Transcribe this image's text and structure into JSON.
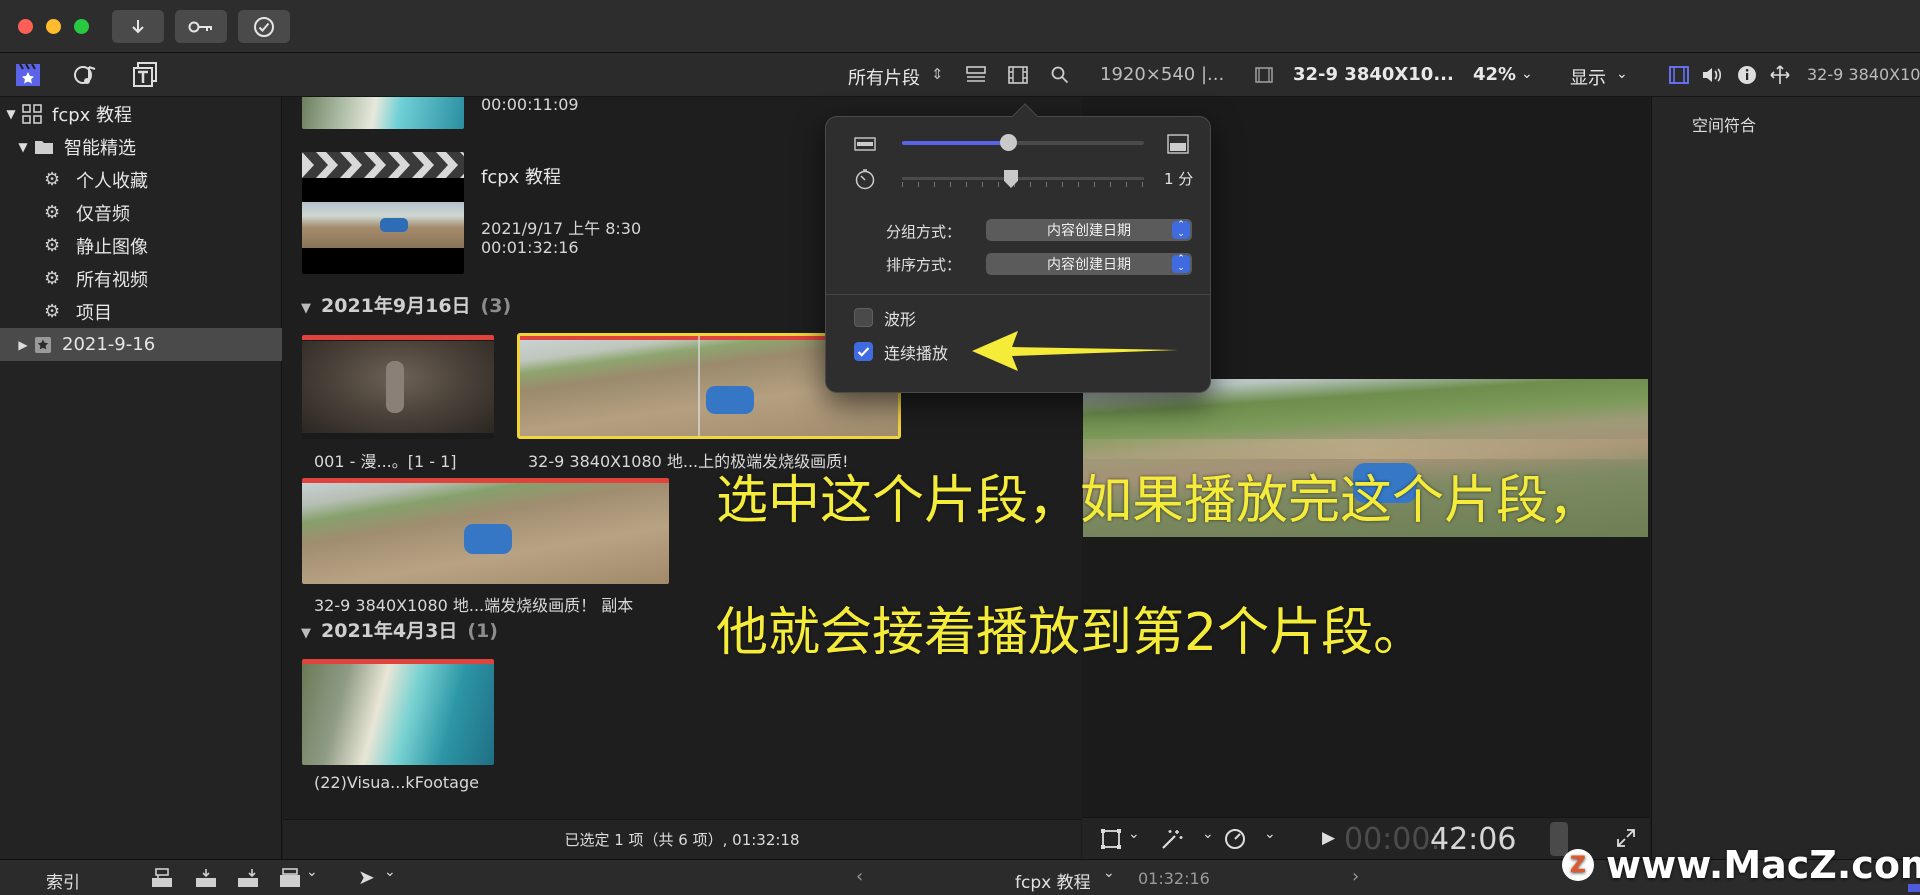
{
  "titlebar": {
    "buttons": [
      "download",
      "key",
      "checkmark"
    ]
  },
  "toolbar": {
    "clips_filter": "所有片段",
    "viewer_format": "1920×540 |...",
    "viewer_clip": "32-9 3840X10...",
    "zoom": "42%",
    "display": "显示",
    "inspector_title": "32-9 3840X10"
  },
  "sidebar": {
    "library": "fcpx 教程",
    "smart_folder": "智能精选",
    "items": [
      "个人收藏",
      "仅音频",
      "静止图像",
      "所有视频",
      "项目"
    ],
    "event": "2021-9-16"
  },
  "browser": {
    "top_clip_duration": "00:00:11:09",
    "project_name": "fcpx 教程",
    "project_date": "2021/9/17 上午 8:30",
    "project_duration": "00:01:32:16",
    "group1": {
      "title": "2021年9月16日",
      "count": "(3)"
    },
    "clips": [
      "001 - 漫...。[1 - 1]",
      "32-9 3840X1080 地...上的极端发烧级画质!",
      "32-9 3840X1080 地...端发烧级画质！ 副本"
    ],
    "group2": {
      "title": "2021年4月3日",
      "count": "(1)"
    },
    "clip4": "(22)Visua...kFootage",
    "status": "已选定 1 项（共 6 项）, 01:32:18"
  },
  "popover": {
    "duration_label": "1 分",
    "group_by_label": "分组方式：",
    "group_by_value": "内容创建日期",
    "sort_by_label": "排序方式：",
    "sort_by_value": "内容创建日期",
    "waveform_label": "波形",
    "continuous_label": "连续播放",
    "waveform_checked": false,
    "continuous_checked": true
  },
  "viewer": {
    "timecode_dim": "00:00:",
    "timecode": "42:06"
  },
  "inspector": {
    "spatial_conform": "空间符合"
  },
  "bottombar": {
    "index": "索引",
    "project": "fcpx 教程",
    "duration": "01:32:16"
  },
  "captions": {
    "line1": "选中这个片段，如果播放完这个片段，",
    "line2": "他就会接着播放到第2个片段。"
  },
  "watermark": "www.MacZ.com",
  "colors": {
    "accent": "#5b63e8",
    "caption": "#f5ec3a",
    "selection": "#f3d43a",
    "clip_marker": "#e0423c"
  }
}
